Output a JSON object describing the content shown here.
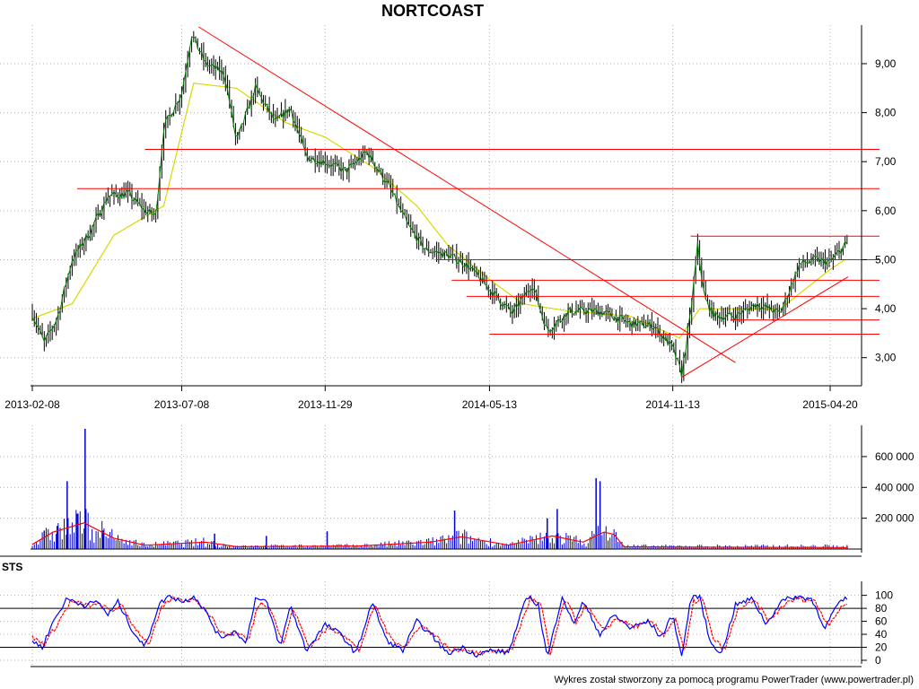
{
  "chart_data": [
    {
      "type": "candlestick",
      "title": "NORTCOAST",
      "x_tick_labels": [
        "2013-02-08",
        "2013-07-08",
        "2013-11-29",
        "2014-05-13",
        "2014-11-13",
        "2015-04-20"
      ],
      "y_tick_labels": [
        "9,00",
        "8,00",
        "7,00",
        "6,00",
        "5,00",
        "4,00",
        "3,00"
      ],
      "y_ticks": [
        9,
        8,
        7,
        6,
        5,
        4,
        3
      ],
      "ylim": [
        2.5,
        9.75
      ],
      "grid": true,
      "price_path": [
        [
          "2013-02-08",
          3.9
        ],
        [
          "2013-02-20",
          3.3
        ],
        [
          "2013-03-05",
          3.8
        ],
        [
          "2013-03-20",
          5.0
        ],
        [
          "2013-04-08",
          5.6
        ],
        [
          "2013-04-25",
          6.3
        ],
        [
          "2013-05-15",
          6.35
        ],
        [
          "2013-06-01",
          6.0
        ],
        [
          "2013-06-12",
          5.9
        ],
        [
          "2013-06-20",
          7.7
        ],
        [
          "2013-07-08",
          8.4
        ],
        [
          "2013-07-18",
          9.6
        ],
        [
          "2013-08-01",
          9.0
        ],
        [
          "2013-08-20",
          8.8
        ],
        [
          "2013-09-01",
          7.4
        ],
        [
          "2013-09-20",
          8.5
        ],
        [
          "2013-10-10",
          7.8
        ],
        [
          "2013-10-25",
          8.1
        ],
        [
          "2013-11-10",
          7.1
        ],
        [
          "2013-11-29",
          7.0
        ],
        [
          "2013-12-20",
          6.8
        ],
        [
          "2014-01-10",
          7.2
        ],
        [
          "2014-02-01",
          6.5
        ],
        [
          "2014-02-20",
          5.7
        ],
        [
          "2014-03-10",
          5.2
        ],
        [
          "2014-04-01",
          5.1
        ],
        [
          "2014-04-20",
          4.9
        ],
        [
          "2014-05-13",
          4.4
        ],
        [
          "2014-06-05",
          3.9
        ],
        [
          "2014-06-25",
          4.5
        ],
        [
          "2014-07-10",
          3.55
        ],
        [
          "2014-08-01",
          3.95
        ],
        [
          "2014-09-01",
          3.95
        ],
        [
          "2014-10-01",
          3.7
        ],
        [
          "2014-10-25",
          3.65
        ],
        [
          "2014-11-13",
          3.2
        ],
        [
          "2014-11-22",
          2.65
        ],
        [
          "2014-12-01",
          3.9
        ],
        [
          "2014-12-08",
          5.3
        ],
        [
          "2014-12-15",
          4.2
        ],
        [
          "2014-12-25",
          3.85
        ],
        [
          "2015-01-15",
          3.85
        ],
        [
          "2015-02-05",
          4.1
        ],
        [
          "2015-03-01",
          3.9
        ],
        [
          "2015-03-20",
          4.9
        ],
        [
          "2015-04-05",
          5.0
        ],
        [
          "2015-04-20",
          4.95
        ],
        [
          "2015-05-05",
          5.3
        ]
      ],
      "ma_path": [
        [
          "2013-02-08",
          3.8
        ],
        [
          "2013-03-20",
          4.1
        ],
        [
          "2013-05-01",
          5.5
        ],
        [
          "2013-06-20",
          6.1
        ],
        [
          "2013-07-20",
          8.6
        ],
        [
          "2013-09-01",
          8.5
        ],
        [
          "2013-10-20",
          7.8
        ],
        [
          "2013-11-29",
          7.5
        ],
        [
          "2014-01-15",
          6.9
        ],
        [
          "2014-03-01",
          6.1
        ],
        [
          "2014-04-01",
          5.3
        ],
        [
          "2014-05-13",
          4.6
        ],
        [
          "2014-06-15",
          4.1
        ],
        [
          "2014-08-01",
          3.95
        ],
        [
          "2014-10-01",
          3.85
        ],
        [
          "2014-11-20",
          3.4
        ],
        [
          "2014-12-10",
          4.0
        ],
        [
          "2015-01-10",
          4.0
        ],
        [
          "2015-03-01",
          4.0
        ],
        [
          "2015-04-20",
          4.8
        ],
        [
          "2015-05-05",
          5.0
        ]
      ],
      "trend_lines": [
        {
          "from": [
            "2013-07-25",
            9.75
          ],
          "to": [
            "2015-01-15",
            2.9
          ]
        },
        {
          "from": [
            "2014-11-22",
            2.6
          ],
          "to": [
            "2015-05-08",
            4.65
          ]
        }
      ],
      "support_resistance_lines": [
        {
          "y": 7.25,
          "from": "2013-06-01",
          "to": "2015-05-08"
        },
        {
          "y": 6.45,
          "from": "2013-03-25",
          "to": "2015-05-08"
        },
        {
          "y": 5.48,
          "from": "2014-12-01",
          "to": "2015-05-08"
        },
        {
          "y": 5.0,
          "from": "2014-03-20",
          "to": "2015-05-08"
        },
        {
          "y": 4.58,
          "from": "2014-04-05",
          "to": "2015-05-08"
        },
        {
          "y": 4.25,
          "from": "2014-04-20",
          "to": "2015-05-08"
        },
        {
          "y": 3.77,
          "from": "2015-01-10",
          "to": "2015-05-08"
        },
        {
          "y": 3.48,
          "from": "2014-05-13",
          "to": "2015-05-08"
        }
      ]
    },
    {
      "type": "bar",
      "y_tick_labels": [
        "600 000",
        "400 000",
        "200 000"
      ],
      "y_ticks": [
        600000,
        400000,
        200000
      ],
      "ylim": [
        0,
        780000
      ],
      "volume_spikes": [
        [
          "2013-02-20",
          120000
        ],
        [
          "2013-03-05",
          150000
        ],
        [
          "2013-03-15",
          440000
        ],
        [
          "2013-03-25",
          230000
        ],
        [
          "2013-04-02",
          780000
        ],
        [
          "2013-04-20",
          120000
        ],
        [
          "2013-08-10",
          100000
        ],
        [
          "2013-10-01",
          85000
        ],
        [
          "2013-12-01",
          115000
        ],
        [
          "2014-04-08",
          250000
        ],
        [
          "2014-07-10",
          200000
        ],
        [
          "2014-07-20",
          260000
        ],
        [
          "2014-08-28",
          460000
        ],
        [
          "2014-09-01",
          440000
        ]
      ],
      "base_level": 20000,
      "ma_path": [
        [
          "2013-02-08",
          30000
        ],
        [
          "2013-03-01",
          110000
        ],
        [
          "2013-04-01",
          170000
        ],
        [
          "2013-05-01",
          70000
        ],
        [
          "2013-06-01",
          25000
        ],
        [
          "2013-08-01",
          45000
        ],
        [
          "2013-09-01",
          15000
        ],
        [
          "2014-01-01",
          20000
        ],
        [
          "2014-03-15",
          45000
        ],
        [
          "2014-04-15",
          80000
        ],
        [
          "2014-06-01",
          25000
        ],
        [
          "2014-07-15",
          85000
        ],
        [
          "2014-08-15",
          45000
        ],
        [
          "2014-09-05",
          110000
        ],
        [
          "2014-09-15",
          95000
        ],
        [
          "2014-09-25",
          15000
        ],
        [
          "2014-12-01",
          12000
        ],
        [
          "2015-05-08",
          10000
        ]
      ]
    },
    {
      "type": "line",
      "title": "STS",
      "y_tick_labels": [
        "100",
        "80",
        "60",
        "40",
        "20",
        "0"
      ],
      "y_ticks": [
        100,
        80,
        60,
        40,
        20,
        0
      ],
      "ylim": [
        0,
        105
      ],
      "ref_lines": [
        80,
        20
      ],
      "series_k": [
        [
          "2013-02-08",
          30
        ],
        [
          "2013-02-18",
          20
        ],
        [
          "2013-03-01",
          60
        ],
        [
          "2013-03-15",
          95
        ],
        [
          "2013-04-01",
          85
        ],
        [
          "2013-04-15",
          90
        ],
        [
          "2013-04-25",
          70
        ],
        [
          "2013-05-05",
          90
        ],
        [
          "2013-05-20",
          45
        ],
        [
          "2013-06-01",
          20
        ],
        [
          "2013-06-15",
          85
        ],
        [
          "2013-06-25",
          100
        ],
        [
          "2013-07-10",
          90
        ],
        [
          "2013-07-20",
          100
        ],
        [
          "2013-08-01",
          75
        ],
        [
          "2013-08-15",
          35
        ],
        [
          "2013-09-01",
          45
        ],
        [
          "2013-09-10",
          25
        ],
        [
          "2013-09-20",
          95
        ],
        [
          "2013-10-01",
          90
        ],
        [
          "2013-10-15",
          20
        ],
        [
          "2013-10-25",
          85
        ],
        [
          "2013-11-10",
          15
        ],
        [
          "2013-11-29",
          55
        ],
        [
          "2013-12-15",
          40
        ],
        [
          "2013-12-30",
          10
        ],
        [
          "2014-01-15",
          90
        ],
        [
          "2014-01-30",
          30
        ],
        [
          "2014-02-15",
          15
        ],
        [
          "2014-03-01",
          60
        ],
        [
          "2014-03-15",
          40
        ],
        [
          "2014-04-01",
          10
        ],
        [
          "2014-04-15",
          20
        ],
        [
          "2014-05-01",
          8
        ],
        [
          "2014-05-13",
          15
        ],
        [
          "2014-06-01",
          12
        ],
        [
          "2014-06-20",
          100
        ],
        [
          "2014-07-01",
          85
        ],
        [
          "2014-07-10",
          3
        ],
        [
          "2014-07-25",
          100
        ],
        [
          "2014-08-05",
          55
        ],
        [
          "2014-08-15",
          90
        ],
        [
          "2014-09-01",
          40
        ],
        [
          "2014-09-15",
          70
        ],
        [
          "2014-10-01",
          50
        ],
        [
          "2014-10-20",
          60
        ],
        [
          "2014-11-01",
          35
        ],
        [
          "2014-11-13",
          70
        ],
        [
          "2014-11-22",
          5
        ],
        [
          "2014-12-01",
          95
        ],
        [
          "2014-12-10",
          100
        ],
        [
          "2014-12-20",
          30
        ],
        [
          "2015-01-01",
          10
        ],
        [
          "2015-01-15",
          85
        ],
        [
          "2015-02-01",
          95
        ],
        [
          "2015-02-15",
          55
        ],
        [
          "2015-03-01",
          90
        ],
        [
          "2015-03-15",
          98
        ],
        [
          "2015-04-01",
          95
        ],
        [
          "2015-04-15",
          50
        ],
        [
          "2015-04-25",
          80
        ],
        [
          "2015-05-05",
          95
        ]
      ],
      "series_d": [
        [
          "2013-02-08",
          35
        ],
        [
          "2013-02-20",
          25
        ],
        [
          "2013-03-05",
          55
        ],
        [
          "2013-03-18",
          90
        ],
        [
          "2013-04-05",
          85
        ],
        [
          "2013-04-18",
          85
        ],
        [
          "2013-04-28",
          75
        ],
        [
          "2013-05-08",
          85
        ],
        [
          "2013-05-22",
          50
        ],
        [
          "2013-06-05",
          25
        ],
        [
          "2013-06-18",
          80
        ],
        [
          "2013-06-28",
          95
        ],
        [
          "2013-07-12",
          92
        ],
        [
          "2013-07-22",
          95
        ],
        [
          "2013-08-05",
          70
        ],
        [
          "2013-08-18",
          40
        ],
        [
          "2013-09-04",
          42
        ],
        [
          "2013-09-13",
          30
        ],
        [
          "2013-09-23",
          88
        ],
        [
          "2013-10-04",
          85
        ],
        [
          "2013-10-18",
          25
        ],
        [
          "2013-10-28",
          80
        ],
        [
          "2013-11-13",
          20
        ],
        [
          "2013-12-02",
          50
        ],
        [
          "2013-12-18",
          40
        ],
        [
          "2014-01-02",
          15
        ],
        [
          "2014-01-18",
          85
        ],
        [
          "2014-02-02",
          35
        ],
        [
          "2014-02-18",
          20
        ],
        [
          "2014-03-04",
          55
        ],
        [
          "2014-03-18",
          40
        ],
        [
          "2014-04-04",
          15
        ],
        [
          "2014-04-18",
          18
        ],
        [
          "2014-05-04",
          10
        ],
        [
          "2014-05-16",
          15
        ],
        [
          "2014-06-04",
          15
        ],
        [
          "2014-06-23",
          95
        ],
        [
          "2014-07-04",
          85
        ],
        [
          "2014-07-13",
          8
        ],
        [
          "2014-07-28",
          95
        ],
        [
          "2014-08-08",
          60
        ],
        [
          "2014-08-18",
          85
        ],
        [
          "2014-09-04",
          45
        ],
        [
          "2014-09-18",
          65
        ],
        [
          "2014-10-04",
          52
        ],
        [
          "2014-10-23",
          58
        ],
        [
          "2014-11-04",
          40
        ],
        [
          "2014-11-16",
          65
        ],
        [
          "2014-11-25",
          10
        ],
        [
          "2014-12-04",
          90
        ],
        [
          "2014-12-13",
          95
        ],
        [
          "2014-12-23",
          35
        ],
        [
          "2015-01-04",
          15
        ],
        [
          "2015-01-18",
          80
        ],
        [
          "2015-02-04",
          90
        ],
        [
          "2015-02-18",
          60
        ],
        [
          "2015-03-04",
          85
        ],
        [
          "2015-03-18",
          95
        ],
        [
          "2015-04-04",
          92
        ],
        [
          "2015-04-18",
          55
        ],
        [
          "2015-04-28",
          75
        ],
        [
          "2015-05-08",
          90
        ]
      ]
    }
  ],
  "footer": {
    "credit": "Wykres został stworzony za pomocą programu PowerTrader (www.powertrader.pl)"
  },
  "colors": {
    "candle": "#000000",
    "price_line": "#008000",
    "ma": "#d8d800",
    "trend": "#ff0000",
    "volume_bar": "#0000cc",
    "volume_ma": "#ff0000",
    "sts_k": "#0000ff",
    "sts_d": "#ff0000",
    "grid": "#b0b0b0"
  }
}
